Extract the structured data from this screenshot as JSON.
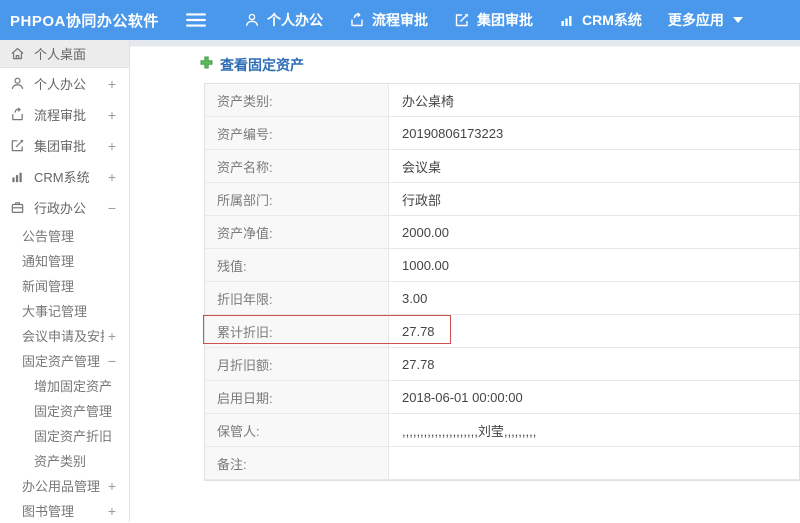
{
  "header": {
    "logo": "PHPOA协同办公软件",
    "nav": [
      {
        "label": "个人办公"
      },
      {
        "label": "流程审批"
      },
      {
        "label": "集团审批"
      },
      {
        "label": "CRM系统"
      },
      {
        "label": "更多应用"
      }
    ]
  },
  "sidebar": {
    "items": [
      {
        "label": "个人桌面"
      },
      {
        "label": "个人办公",
        "toggle": "+"
      },
      {
        "label": "流程审批",
        "toggle": "+"
      },
      {
        "label": "集团审批",
        "toggle": "+"
      },
      {
        "label": "CRM系统",
        "toggle": "+"
      },
      {
        "label": "行政办公",
        "toggle": "−"
      },
      {
        "label": "公告管理"
      },
      {
        "label": "通知管理"
      },
      {
        "label": "新闻管理"
      },
      {
        "label": "大事记管理"
      },
      {
        "label": "会议申请及安排",
        "toggle": "+"
      },
      {
        "label": "固定资产管理",
        "toggle": "−"
      },
      {
        "label": "增加固定资产"
      },
      {
        "label": "固定资产管理"
      },
      {
        "label": "固定资产折旧"
      },
      {
        "label": "资产类别"
      },
      {
        "label": "办公用品管理",
        "toggle": "+"
      },
      {
        "label": "图书管理",
        "toggle": "+"
      }
    ]
  },
  "main": {
    "title": "查看固定资产",
    "table": {
      "rows": [
        {
          "label": "资产类别:",
          "value": "办公桌椅"
        },
        {
          "label": "资产编号:",
          "value": "20190806173223"
        },
        {
          "label": "资产名称:",
          "value": "会议桌"
        },
        {
          "label": "所属部门:",
          "value": "行政部"
        },
        {
          "label": "资产净值:",
          "value": "2000.00"
        },
        {
          "label": "残值:",
          "value": "1000.00"
        },
        {
          "label": "折旧年限:",
          "value": "3.00"
        },
        {
          "label": "累计折旧:",
          "value": "27.78"
        },
        {
          "label": "月折旧额:",
          "value": "27.78"
        },
        {
          "label": "启用日期:",
          "value": "2018-06-01 00:00:00"
        },
        {
          "label": "保管人:",
          "value": ",,,,,,,,,,,,,,,,,,,,,刘莹,,,,,,,,,"
        },
        {
          "label": "备注:",
          "value": ""
        }
      ]
    }
  },
  "colors": {
    "header_bg": "#4a98ec",
    "title_text": "#2d6db5",
    "highlight_border": "#d0504e",
    "plus_icon_green": "#5cb85c"
  }
}
